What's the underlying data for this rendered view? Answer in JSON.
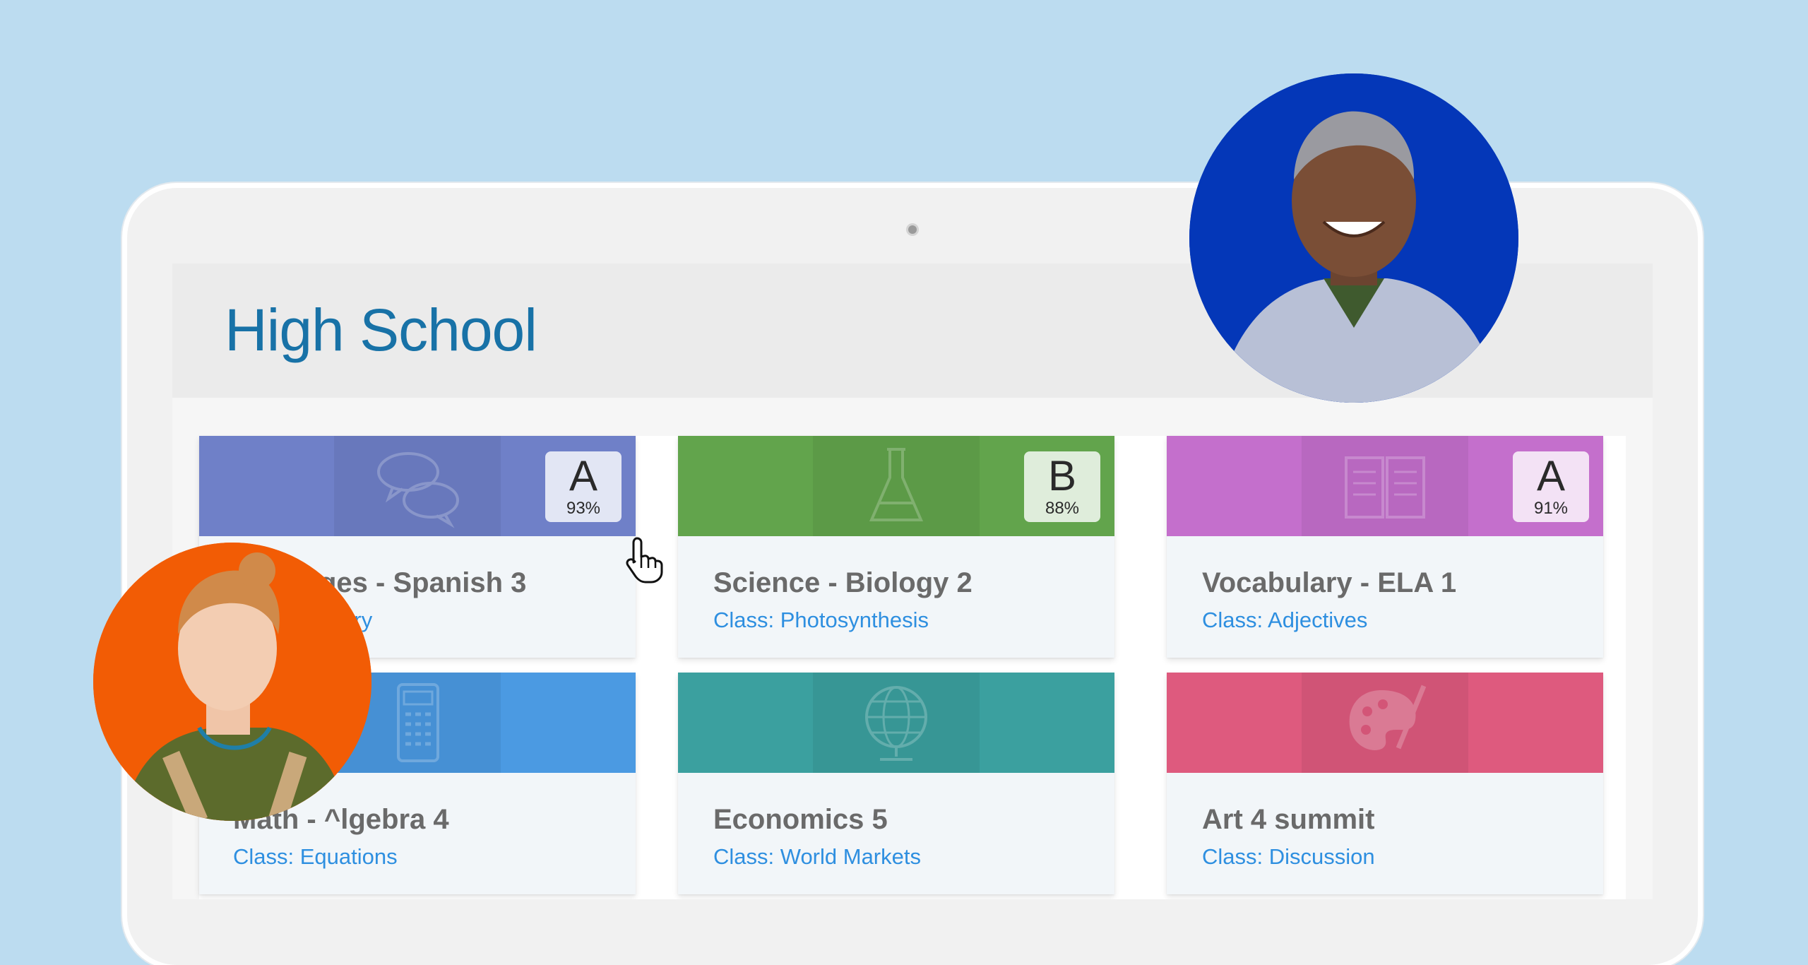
{
  "page": {
    "title": "High School"
  },
  "colors": {
    "background": "#bcdcf0",
    "title": "#1872a7",
    "class_link": "#2e8fe0"
  },
  "courses": [
    {
      "title": "ges - Spanish 3",
      "class_label": "ulary",
      "banner_color": "#6f80c8",
      "art_icon": "speech-bubbles-icon",
      "grade": "A",
      "grade_percent": "93%"
    },
    {
      "title": "Science - Biology 2",
      "class_label": "Class: Photosynthesis",
      "banner_color": "#62a44c",
      "art_icon": "flask-icon",
      "grade": "B",
      "grade_percent": "88%"
    },
    {
      "title": "Vocabulary - ELA 1",
      "class_label": "Class: Adjectives",
      "banner_color": "#c46fcc",
      "art_icon": "book-icon",
      "grade": "A",
      "grade_percent": "91%"
    },
    {
      "title": "Math - ^lgebra 4",
      "class_label": "Class: Equations",
      "banner_color": "#4b9ae2",
      "art_icon": "calculator-icon"
    },
    {
      "title": "Economics 5",
      "class_label": "Class: World Markets",
      "banner_color": "#3ba09f",
      "art_icon": "globe-icon"
    },
    {
      "title": "Art 4 summit",
      "class_label": "Class: Discussion",
      "banner_color": "#de5a7e",
      "art_icon": "paint-palette-icon"
    }
  ],
  "avatars": [
    {
      "name": "student-avatar-boy",
      "ring_color": "#0437b8"
    },
    {
      "name": "student-avatar-girl",
      "ring_color": "#f25c05"
    }
  ]
}
